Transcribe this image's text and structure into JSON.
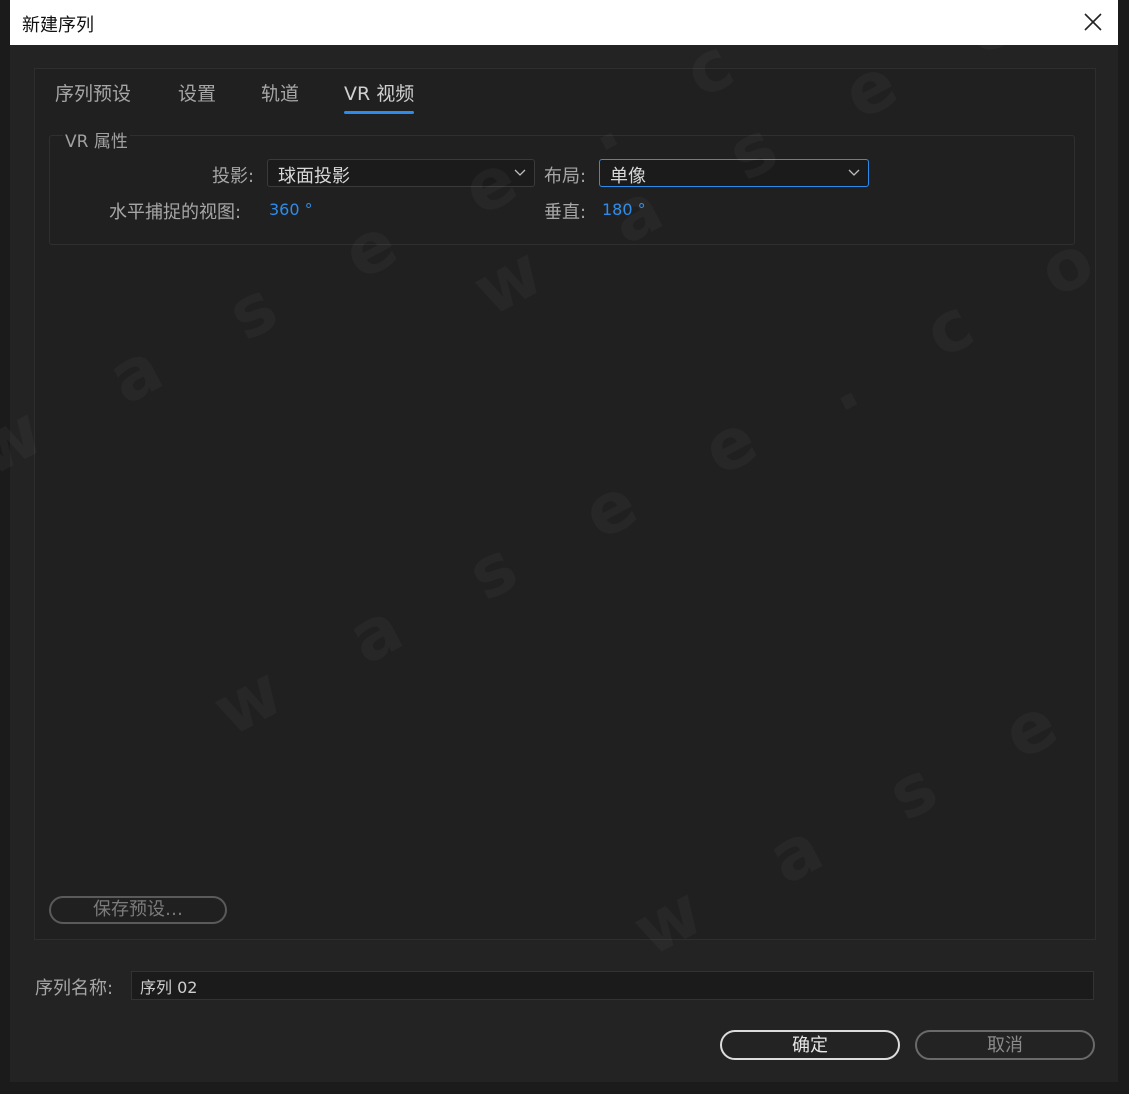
{
  "window": {
    "title": "新建序列"
  },
  "tabs": [
    {
      "label": "序列预设"
    },
    {
      "label": "设置"
    },
    {
      "label": "轨道"
    },
    {
      "label": "VR 视频",
      "active": true
    }
  ],
  "vr": {
    "group_title": "VR 属性",
    "projection_label": "投影:",
    "projection_value": "球面投影",
    "layout_label": "布局:",
    "layout_value": "单像",
    "hfov_label": "水平捕捉的视图:",
    "hfov_value": "360 °",
    "vertical_label": "垂直:",
    "vertical_value": "180 °"
  },
  "save_preset_label": "保存预设…",
  "sequence": {
    "name_label": "序列名称:",
    "name_value": "序列 02"
  },
  "buttons": {
    "ok": "确定",
    "cancel": "取消"
  },
  "watermark_text": "w a s e e . c o m",
  "colors": {
    "accent": "#2d8ceb",
    "background": "#232323",
    "titlebar": "#ffffff"
  },
  "icons": {
    "close": "close-icon",
    "dropdown": "chevron-down-icon"
  }
}
